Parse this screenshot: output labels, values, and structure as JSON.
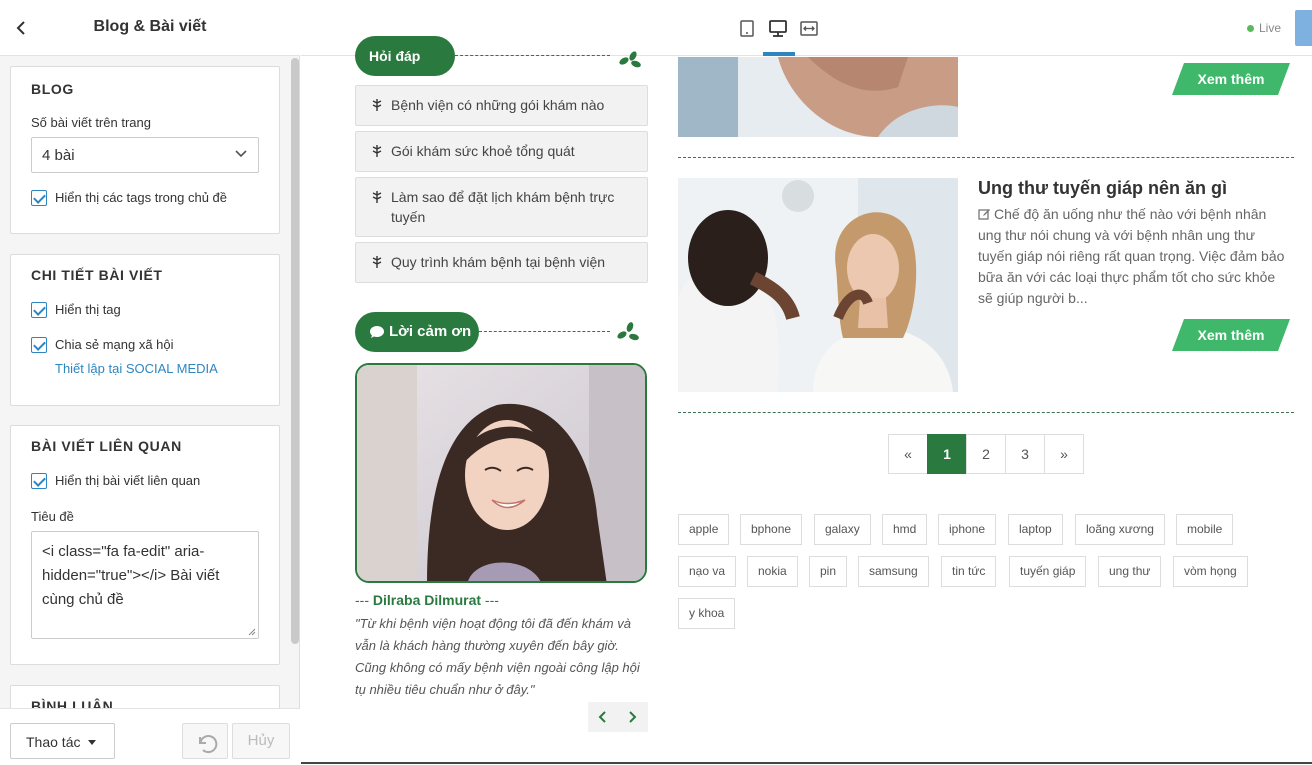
{
  "sidebar": {
    "title": "Blog & Bài viết",
    "blog": {
      "heading": "BLOG",
      "posts_per_page_label": "Số bài viết trên trang",
      "posts_per_page_value": "4 bài",
      "show_tags_label": "Hiển thị các tags trong chủ đề"
    },
    "detail": {
      "heading": "CHI TIẾT BÀI VIẾT",
      "show_tag_label": "Hiển thị tag",
      "share_label": "Chia sẻ mạng xã hội",
      "social_link": "Thiết lập tại SOCIAL MEDIA"
    },
    "related": {
      "heading": "BÀI VIẾT LIÊN QUAN",
      "show_related_label": "Hiển thị bài viết liên quan",
      "title_label": "Tiêu đề",
      "title_value": "<i class=\"fa fa-edit\" aria-hidden=\"true\"></i> Bài viết cùng chủ đề"
    },
    "comments": {
      "heading": "BÌNH LUẬN"
    },
    "footer": {
      "actions_label": "Thao tác",
      "cancel_label": "Hủy"
    }
  },
  "topbar": {
    "live_label": "Live"
  },
  "preview": {
    "faq": {
      "heading": "Hỏi đáp",
      "items": [
        "Bệnh viện có những gói khám nào",
        "Gói khám sức khoẻ tổng quát",
        "Làm sao để đặt lịch khám bệnh trực tuyến",
        "Quy trình khám bệnh tại bệnh viện"
      ]
    },
    "thanks": {
      "heading": "Lời cảm ơn",
      "name_prefix": "---",
      "name": "Dilraba Dilmurat",
      "name_suffix": "---",
      "quote": "\"Từ khi bệnh viện hoạt động tôi đã đến khám và vẫn là khách hàng thường xuyên đến bây giờ. Cũng không có mấy bệnh viện ngoài công lập hội tụ nhiều tiêu chuẩn như ở đây.\""
    },
    "posts": [
      {
        "more_label": "Xem thêm"
      },
      {
        "title": "Ung thư tuyến giáp nên ăn gì",
        "excerpt": "Chế độ ăn uống như thế nào với bệnh nhân ung thư nói chung và với bệnh nhân ung thư tuyến giáp nói riêng rất quan trọng. Việc đảm bảo bữa ăn với các loại thực phẩm tốt cho sức khỏe sẽ giúp người b...",
        "more_label": "Xem thêm"
      }
    ],
    "pagination": {
      "prev": "«",
      "pages": [
        "1",
        "2",
        "3"
      ],
      "active": "1",
      "next": "»"
    },
    "tags": [
      "apple",
      "bphone",
      "galaxy",
      "hmd",
      "iphone",
      "laptop",
      "loãng xương",
      "mobile",
      "nạo va",
      "nokia",
      "pin",
      "samsung",
      "tin tức",
      "tuyến giáp",
      "ung thư",
      "vòm họng",
      "y khoa"
    ],
    "colors": {
      "brand_green": "#2a7a40",
      "button_green": "#3fb86b",
      "accent_blue": "#2e86c1"
    }
  }
}
